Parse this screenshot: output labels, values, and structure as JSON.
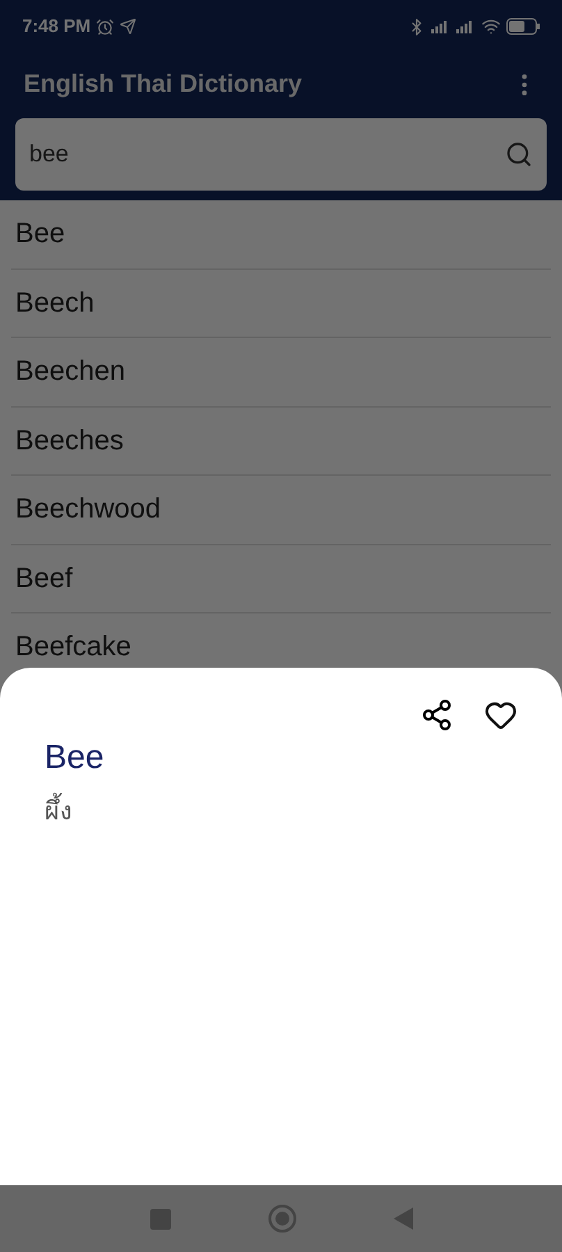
{
  "status_bar": {
    "time": "7:48 PM"
  },
  "app_bar": {
    "title": "English Thai Dictionary"
  },
  "search": {
    "value": "bee"
  },
  "results": [
    "Bee",
    "Beech",
    "Beechen",
    "Beeches",
    "Beechwood",
    "Beef",
    "Beefcake"
  ],
  "sheet": {
    "word": "Bee",
    "translation": "ผึ้ง",
    "favorite": false
  }
}
